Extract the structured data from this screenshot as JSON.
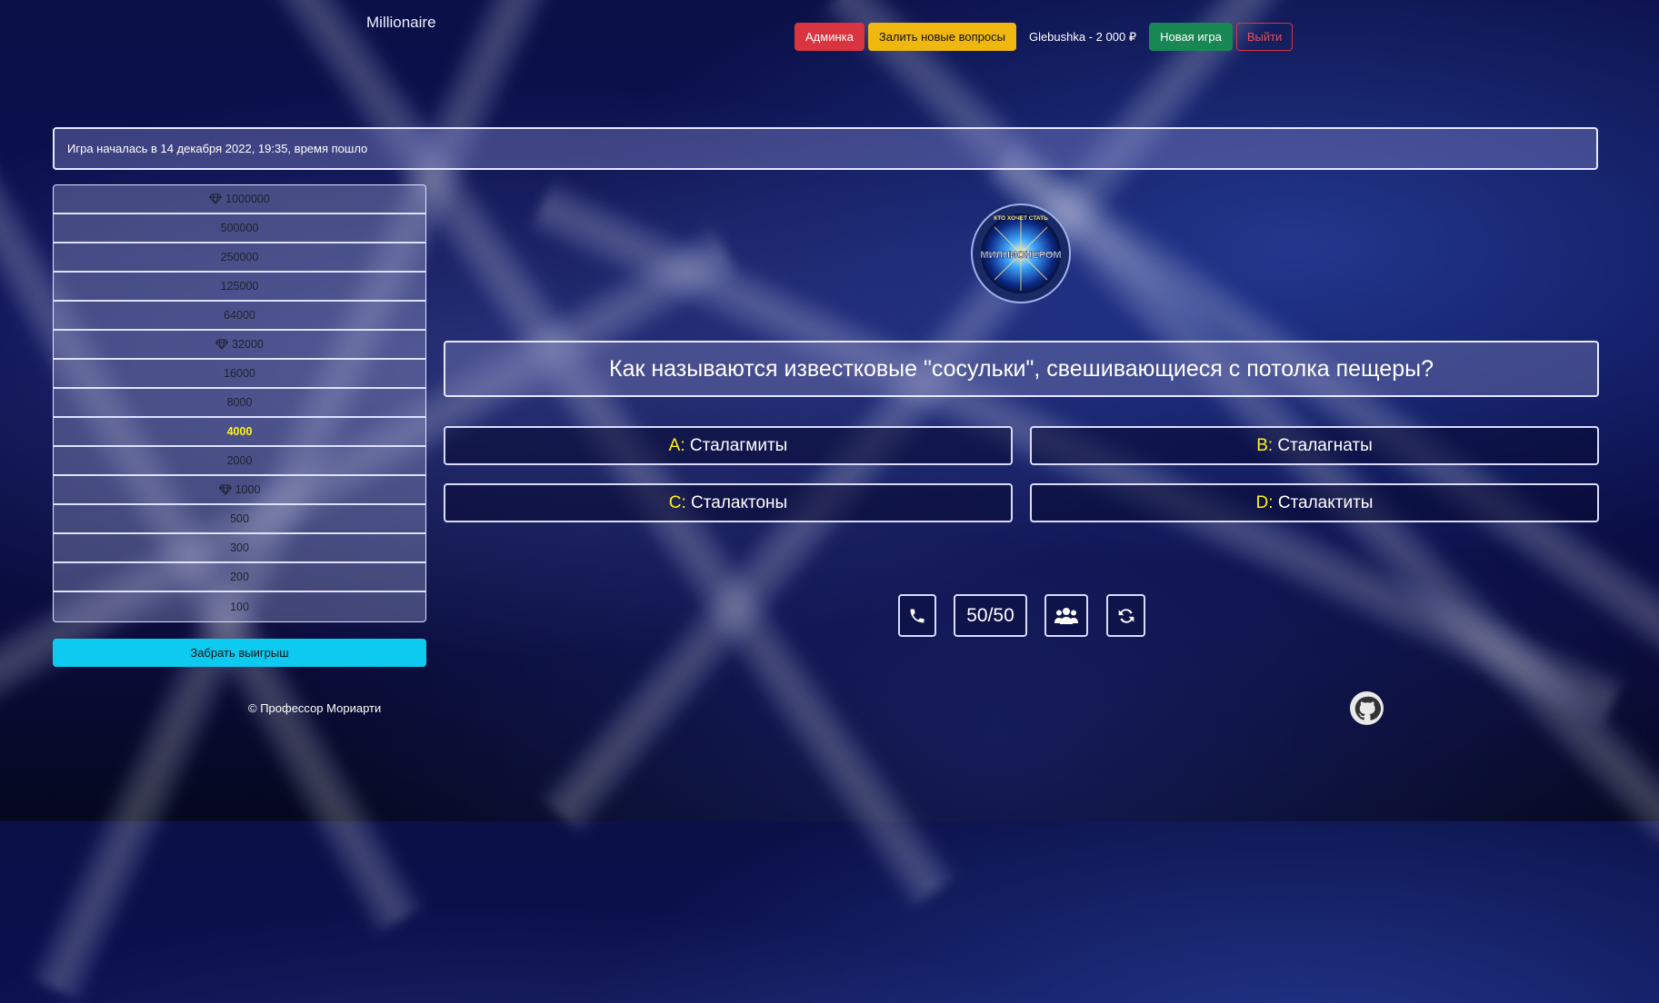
{
  "header": {
    "brand": "Millionaire",
    "admin_label": "Админка",
    "upload_label": "Залить новые вопросы",
    "user_balance": "Glebushka - 2 000 ₽",
    "new_game_label": "Новая игра",
    "logout_label": "Выйти"
  },
  "status": {
    "text": "Игра началась в 14 декабря 2022, 19:35, время пошло"
  },
  "ladder": {
    "levels": [
      {
        "amount": "1000000",
        "safe": true,
        "current": false
      },
      {
        "amount": "500000",
        "safe": false,
        "current": false
      },
      {
        "amount": "250000",
        "safe": false,
        "current": false
      },
      {
        "amount": "125000",
        "safe": false,
        "current": false
      },
      {
        "amount": "64000",
        "safe": false,
        "current": false
      },
      {
        "amount": "32000",
        "safe": true,
        "current": false
      },
      {
        "amount": "16000",
        "safe": false,
        "current": false
      },
      {
        "amount": "8000",
        "safe": false,
        "current": false
      },
      {
        "amount": "4000",
        "safe": false,
        "current": true
      },
      {
        "amount": "2000",
        "safe": false,
        "current": false
      },
      {
        "amount": "1000",
        "safe": true,
        "current": false
      },
      {
        "amount": "500",
        "safe": false,
        "current": false
      },
      {
        "amount": "300",
        "safe": false,
        "current": false
      },
      {
        "amount": "200",
        "safe": false,
        "current": false
      },
      {
        "amount": "100",
        "safe": false,
        "current": false
      }
    ],
    "take_money_label": "Забрать выигрыш"
  },
  "question": {
    "text": "Как называются известковые \"сосульки\", свешивающиеся с потолка пещеры?",
    "answers": [
      {
        "letter": "A:",
        "text": "Сталагмиты"
      },
      {
        "letter": "B:",
        "text": "Сталагнаты"
      },
      {
        "letter": "C:",
        "text": "Сталактоны"
      },
      {
        "letter": "D:",
        "text": "Сталактиты"
      }
    ]
  },
  "lifelines": {
    "fifty_fifty_label": "50/50",
    "icons": [
      "phone-icon",
      "audience-icon",
      "swap-question-icon"
    ]
  },
  "logo": {
    "top_text": "КТО ХОЧЕТ СТАТЬ",
    "main_text": "МИЛЛИОНЕРОМ"
  },
  "footer": {
    "text": "© Профессор Мориарти"
  },
  "colors": {
    "danger": "#d9343f",
    "warning": "#f0b70e",
    "success": "#198754",
    "info": "#0dcaf0",
    "answer_letter": "#fff21a"
  }
}
